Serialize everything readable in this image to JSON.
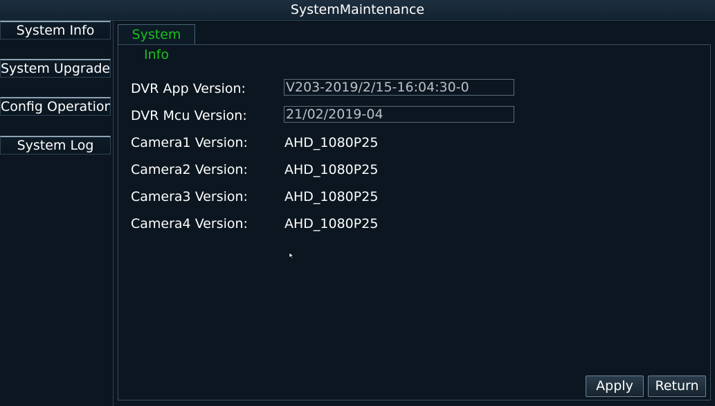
{
  "window": {
    "title": "SystemMaintenance"
  },
  "sidebar": {
    "items": [
      {
        "label": "System Info"
      },
      {
        "label": "System Upgrade"
      },
      {
        "label": "Config Operation"
      },
      {
        "label": "System Log"
      }
    ]
  },
  "tab": {
    "label": "System Info"
  },
  "info": {
    "dvr_app_label": "DVR App Version:",
    "dvr_app_value": "V203-2019/2/15-16:04:30-0",
    "dvr_mcu_label": "DVR Mcu Version:",
    "dvr_mcu_value": "21/02/2019-04",
    "camera1_label": "Camera1 Version:",
    "camera1_value": "AHD_1080P25",
    "camera2_label": "Camera2 Version:",
    "camera2_value": "AHD_1080P25",
    "camera3_label": "Camera3 Version:",
    "camera3_value": "AHD_1080P25",
    "camera4_label": "Camera4 Version:",
    "camera4_value": "AHD_1080P25"
  },
  "buttons": {
    "apply": "Apply",
    "return": "Return"
  },
  "colors": {
    "active_tab_text": "#19c21a",
    "background": "#0b1620"
  },
  "icons": {
    "cursor": "mouse-pointer-icon"
  }
}
